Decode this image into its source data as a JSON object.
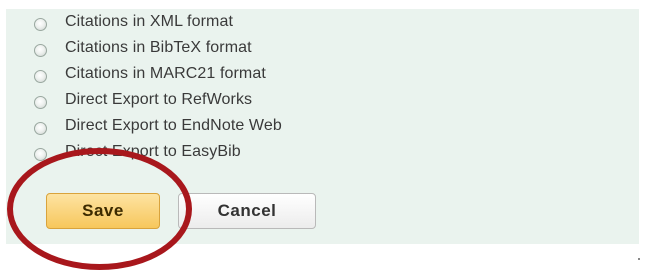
{
  "export_options": [
    {
      "label": "Citations in XML format"
    },
    {
      "label": "Citations in BibTeX format"
    },
    {
      "label": "Citations in MARC21 format"
    },
    {
      "label": "Direct Export to RefWorks"
    },
    {
      "label": "Direct Export to EndNote Web"
    },
    {
      "label": "Direct Export to EasyBib"
    }
  ],
  "actions": {
    "save_label": "Save",
    "cancel_label": "Cancel"
  },
  "colors": {
    "panel_bg": "#eaf3ee",
    "save_bg": "#f7c75c",
    "annotation_circle": "#a8171c"
  }
}
